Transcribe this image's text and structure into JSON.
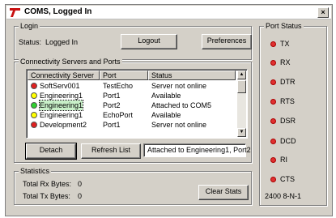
{
  "window": {
    "title": "COMS, Logged In",
    "close": "×"
  },
  "login": {
    "group_label": "Login",
    "status_label": "Status:",
    "status_value": "Logged In",
    "logout": "Logout",
    "preferences": "Preferences"
  },
  "servers": {
    "group_label": "Connectivity Servers and Ports",
    "columns": [
      "Connectivity Server",
      "Port",
      "Status"
    ],
    "rows": [
      {
        "server": "SoftServ001",
        "port": "TestEcho",
        "status": "Server not online",
        "color": "#e02020"
      },
      {
        "server": "Engineering1",
        "port": "Port1",
        "status": "Available",
        "color": "#ffff00"
      },
      {
        "server": "Engineering1",
        "port": "Port2",
        "status": "Attached to COM5",
        "color": "#30d030"
      },
      {
        "server": "Engineering1",
        "port": "EchoPort",
        "status": "Available",
        "color": "#ffff00"
      },
      {
        "server": "Development2",
        "port": "Port1",
        "status": "Server not online",
        "color": "#e02020"
      }
    ],
    "detach": "Detach",
    "refresh": "Refresh List",
    "attach_status": "Attached to Engineering1, Port2"
  },
  "stats": {
    "group_label": "Statistics",
    "rx_label": "Total Rx Bytes:",
    "rx_value": "0",
    "tx_label": "Total Tx Bytes:",
    "tx_value": "0",
    "clear": "Clear Stats"
  },
  "port_status": {
    "group_label": "Port Status",
    "signals": [
      "TX",
      "RX",
      "DTR",
      "RTS",
      "DSR",
      "DCD",
      "RI",
      "CTS"
    ],
    "led_color": "#e03030",
    "config": "2400 8-N-1"
  }
}
